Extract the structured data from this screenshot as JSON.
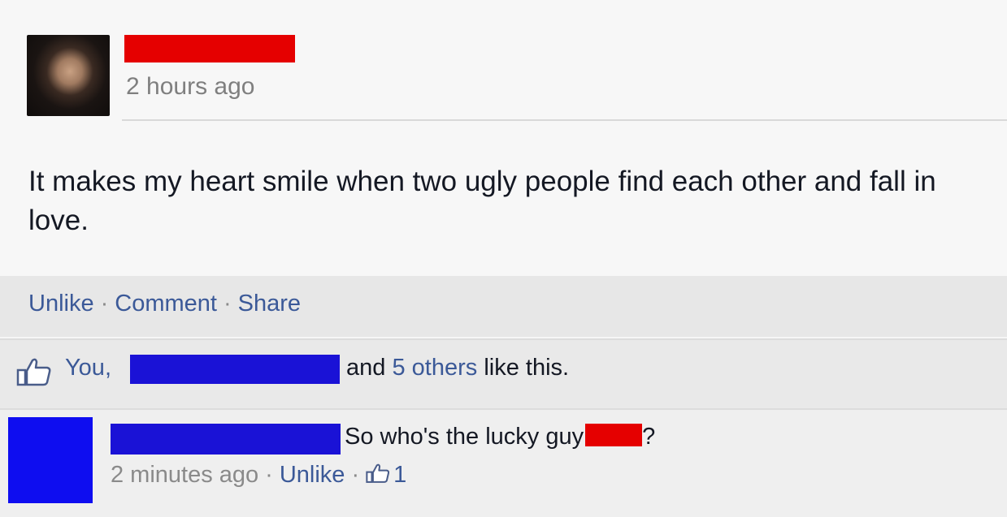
{
  "post": {
    "timestamp": "2 hours ago",
    "text": "It makes my heart smile when two ugly people find each other and fall in love."
  },
  "actions": {
    "unlike": "Unlike",
    "comment": "Comment",
    "share": "Share",
    "separator": "·"
  },
  "likes": {
    "you": "You,",
    "and": "and",
    "others": "5 others",
    "suffix": "like this."
  },
  "comment": {
    "text": "So who's the lucky guy",
    "end": "?",
    "timestamp": "2 minutes ago",
    "unlike": "Unlike",
    "like_count": "1"
  },
  "colors": {
    "link": "#3b5998",
    "redact_red": "#e50000",
    "redact_blue": "#1a12d6"
  }
}
